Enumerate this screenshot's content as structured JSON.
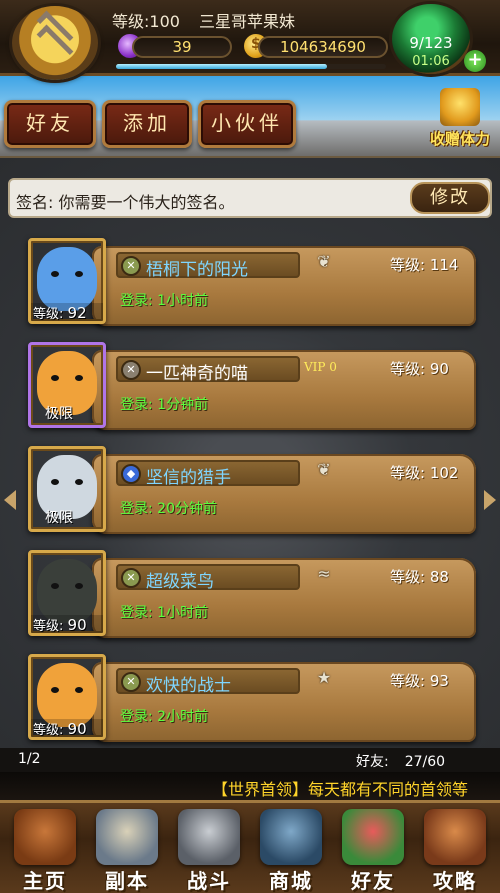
{
  "header": {
    "level_label": "等级:100",
    "player_name": "三星哥苹果妹",
    "gems": "39",
    "gold": "104634690",
    "xp_fraction": 0.78,
    "energy": "9/123",
    "energy_timer": "01:06",
    "plus_symbol": "+"
  },
  "tabs": [
    "好友",
    "添加",
    "小伙伴"
  ],
  "gift": {
    "label": "收赠体力"
  },
  "signature": {
    "text": "签名: 你需要一个伟大的签名。",
    "edit_label": "修改"
  },
  "friends": [
    {
      "name": "梧桐下的阳光",
      "name_color": "#7fd6ff",
      "level": "等级: 114",
      "login": "登录: 1小时前",
      "avatar_level": "等级:",
      "avatar_level_num": "92",
      "limit": "",
      "vip": "",
      "rank_icon": "wings-icon",
      "face_color": "#5a9ee8",
      "frame": "gold"
    },
    {
      "name": "一匹神奇的喵",
      "name_color": "#ffffff",
      "level": "等级: 90",
      "login": "登录: 1分钟前",
      "avatar_level": "",
      "avatar_level_num": "",
      "limit": "极限",
      "vip": "VIP 0",
      "rank_icon": "",
      "face_color": "#f0a23a",
      "frame": "purple"
    },
    {
      "name": "坚信的猎手",
      "name_color": "#7fd6ff",
      "level": "等级: 102",
      "login": "登录: 20分钟前",
      "avatar_level": "",
      "avatar_level_num": "",
      "limit": "极限",
      "vip": "",
      "rank_icon": "wings-icon",
      "face_color": "#cfd8e0",
      "frame": "gold"
    },
    {
      "name": "超级菜鸟",
      "name_color": "#7fd6ff",
      "level": "等级: 88",
      "login": "登录: 1小时前",
      "avatar_level": "等级:",
      "avatar_level_num": "90",
      "limit": "",
      "vip": "",
      "rank_icon": "chevron-rank-icon",
      "face_color": "#3a3f3a",
      "frame": "gold"
    },
    {
      "name": "欢快的战士",
      "name_color": "#7fd6ff",
      "level": "等级: 93",
      "login": "登录: 2小时前",
      "avatar_level": "等级:",
      "avatar_level_num": "90",
      "limit": "",
      "vip": "",
      "rank_icon": "star-rank-icon",
      "face_color": "#f0a23a",
      "frame": "gold"
    }
  ],
  "footer": {
    "page": "1/2",
    "friends_label": "好友:",
    "friends_count": "27/60",
    "marquee": "【世界首领】每天都有不同的首领等"
  },
  "nav": [
    "主页",
    "副本",
    "战斗",
    "商城",
    "好友",
    "攻略"
  ]
}
